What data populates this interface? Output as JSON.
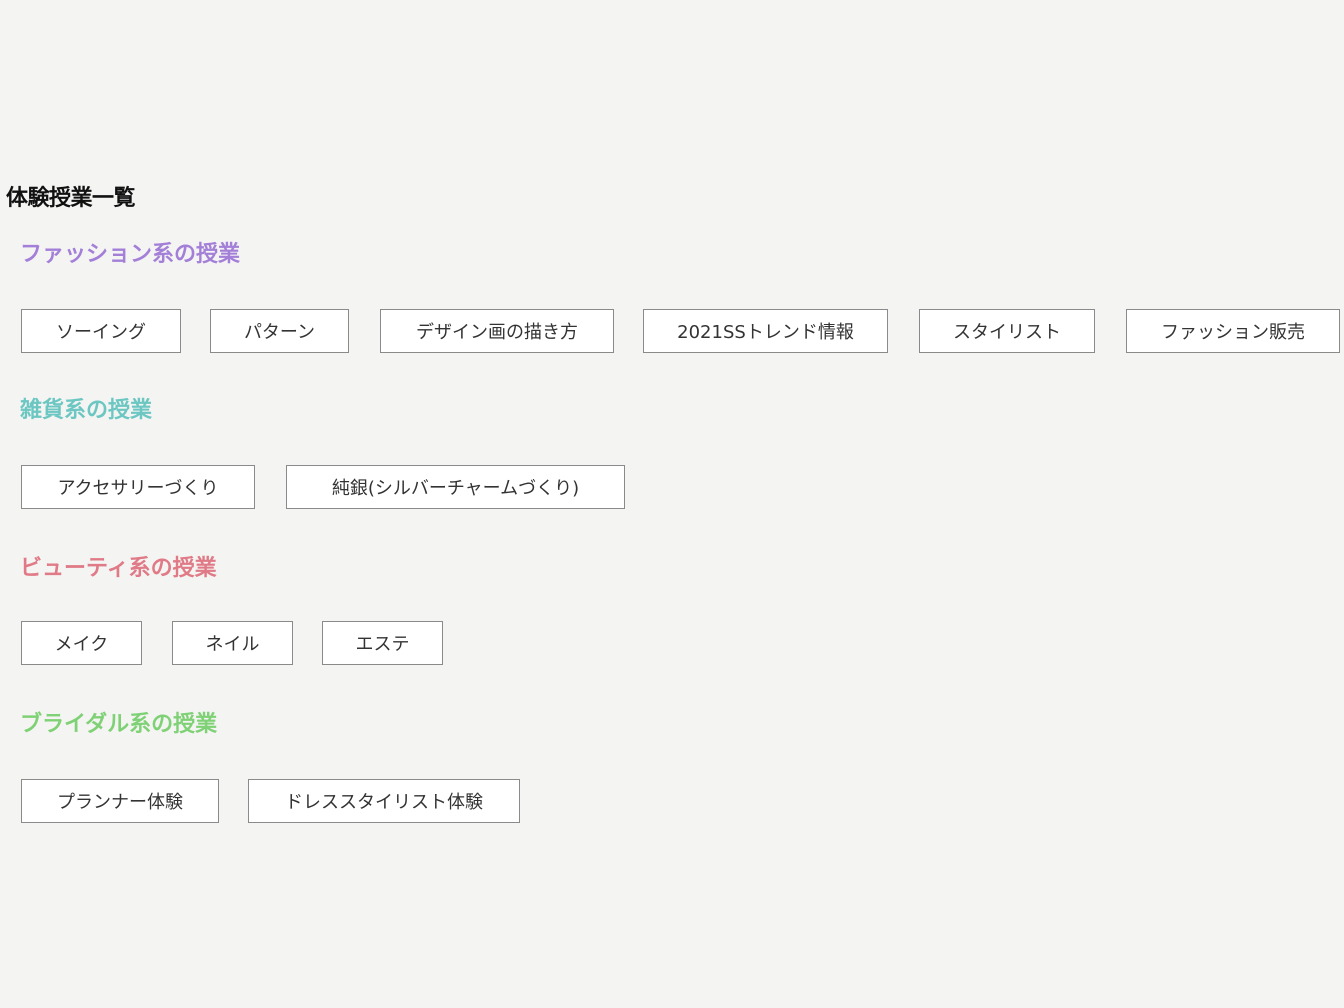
{
  "page": {
    "title": "体験授業一覧"
  },
  "colors": {
    "fashion": "#a37fd8",
    "goods": "#6cc7c2",
    "beauty": "#e07a86",
    "bridal": "#7fd175"
  },
  "sections": [
    {
      "title": "ファッション系の授業",
      "items": [
        "ソーイング",
        "パターン",
        "デザイン画の描き方",
        "2021SSトレンド情報",
        "スタイリスト",
        "ファッション販売"
      ]
    },
    {
      "title": "雑貨系の授業",
      "items": [
        "アクセサリーづくり",
        "純銀(シルバーチャームづくり)"
      ]
    },
    {
      "title": "ビューティ系の授業",
      "items": [
        "メイク",
        "ネイル",
        "エステ"
      ]
    },
    {
      "title": "ブライダル系の授業",
      "items": [
        "プランナー体験",
        "ドレススタイリスト体験"
      ]
    }
  ]
}
